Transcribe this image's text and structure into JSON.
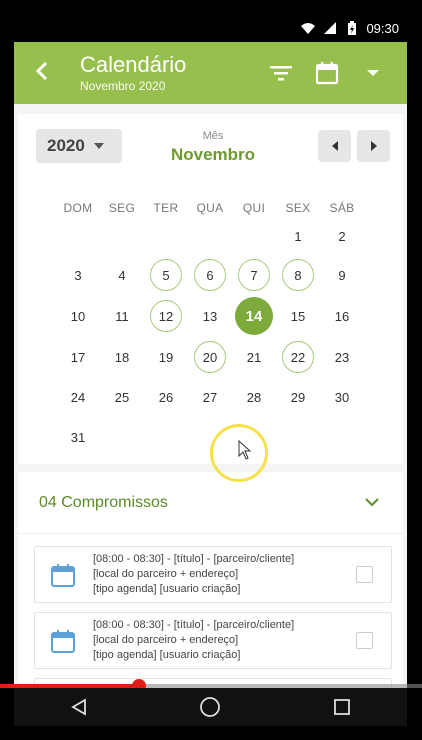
{
  "status": {
    "time": "09:30"
  },
  "appbar": {
    "title": "Calendário",
    "subtitle": "Novembro 2020",
    "back_icon": "back-arrow-icon",
    "filter_icon": "filter-icon",
    "calendar_icon": "calendar-icon",
    "menu_icon": "dropdown-caret-icon"
  },
  "calendar": {
    "year": "2020",
    "month_label": "Mês",
    "month": "Novembro",
    "weekdays": [
      "DOM",
      "SEG",
      "TER",
      "QUA",
      "QUI",
      "SEX",
      "SÁB"
    ],
    "first_weekday_index": 0,
    "days_in_month": 30,
    "rows": [
      [
        "",
        "",
        "",
        "",
        "",
        "1",
        "2"
      ],
      [
        "3",
        "4",
        "5",
        "6",
        "7",
        "8",
        "9"
      ],
      [
        "10",
        "11",
        "12",
        "13",
        "14",
        "15",
        "16"
      ],
      [
        "17",
        "18",
        "19",
        "20",
        "21",
        "22",
        "23"
      ],
      [
        "24",
        "25",
        "26",
        "27",
        "28",
        "29",
        "30"
      ],
      [
        "31",
        "",
        "",
        "",
        "",
        "",
        ""
      ]
    ],
    "highlighted_days": [
      "5",
      "6",
      "7",
      "8",
      "12",
      "20",
      "22"
    ],
    "selected_day": "14",
    "accent": "#97bf4d",
    "selected_color": "#7cab3c"
  },
  "agenda": {
    "count_label": "04 Compromissos",
    "items": [
      {
        "line1": "[08:00 - 08:30]  -  [título]  -  [parceiro/cliente]",
        "line2": "[local do parceiro + endereço]",
        "line3": "[tipo agenda] [usuario criação]"
      },
      {
        "line1": "[08:00 - 08:30]  -  [título]  -  [parceiro/cliente]",
        "line2": "[local do parceiro + endereço]",
        "line3": "[tipo agenda] [usuario criação]"
      }
    ]
  },
  "video": {
    "progress": 0.33
  }
}
